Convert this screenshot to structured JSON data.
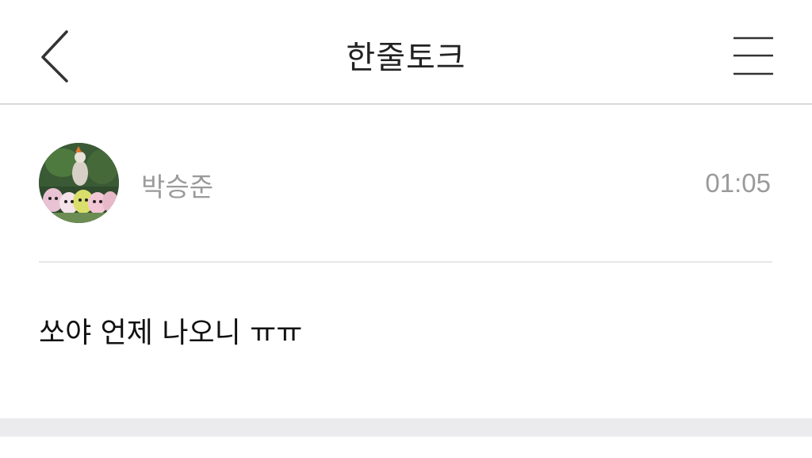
{
  "header": {
    "title": "한줄토크",
    "back_icon": "chevron-left-icon",
    "menu_icon": "hamburger-menu-icon"
  },
  "post": {
    "author": "박승준",
    "time": "01:05",
    "message": "쏘야 언제 나오니 ㅠㅠ",
    "avatar_icon": "avatar-image"
  },
  "colors": {
    "background": "#ffffff",
    "text_primary": "#222222",
    "text_secondary": "#9a9a9a",
    "divider": "#e6e6e6",
    "footer_bar": "#ebebee"
  }
}
